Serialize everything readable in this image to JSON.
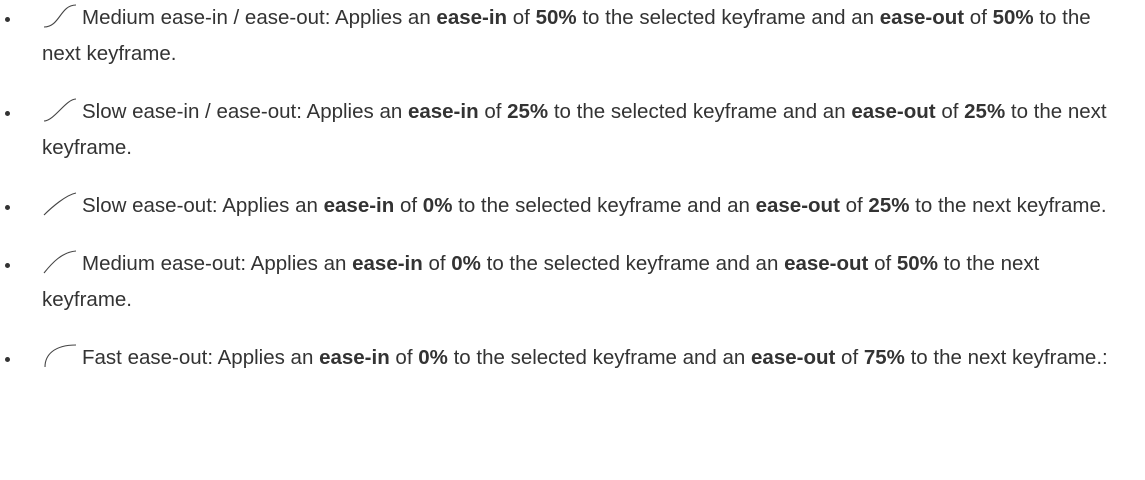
{
  "items": [
    {
      "icon": "medium-ease-in-out-curve-icon",
      "label": "Medium ease-in / ease-out:",
      "t1": "Applies an",
      "b1": "ease-in",
      "t2": "of",
      "b2": "50%",
      "t3": "to the selected keyframe and an",
      "b3": "ease-out",
      "t4": "of",
      "b4": "50%",
      "t5": "to the next keyframe."
    },
    {
      "icon": "slow-ease-in-out-curve-icon",
      "label": "Slow ease-in / ease-out:",
      "t1": "Applies an",
      "b1": "ease-in",
      "t2": "of",
      "b2": "25%",
      "t3": "to the selected keyframe and an",
      "b3": "ease-out",
      "t4": "of",
      "b4": "25%",
      "t5": "to the next keyframe."
    },
    {
      "icon": "slow-ease-out-curve-icon",
      "label": "Slow ease-out:",
      "t1": "Applies an",
      "b1": "ease-in",
      "t2": "of",
      "b2": "0%",
      "t3": "to the selected keyframe and an",
      "b3": "ease-out",
      "t4": "of",
      "b4": "25%",
      "t5": "to the next keyframe."
    },
    {
      "icon": "medium-ease-out-curve-icon",
      "label": "Medium ease-out:",
      "t1": "Applies an",
      "b1": "ease-in",
      "t2": "of",
      "b2": "0%",
      "t3": "to the selected keyframe and an",
      "b3": "ease-out",
      "t4": "of",
      "b4": "50%",
      "t5": "to the next keyframe."
    },
    {
      "icon": "fast-ease-out-curve-icon",
      "label": "Fast ease-out:",
      "t1": "Applies an",
      "b1": "ease-in",
      "t2": "of",
      "b2": "0%",
      "t3": "to the selected keyframe and an",
      "b3": "ease-out",
      "t4": "of",
      "b4": "75%",
      "t5": "to the next keyframe.:"
    }
  ]
}
